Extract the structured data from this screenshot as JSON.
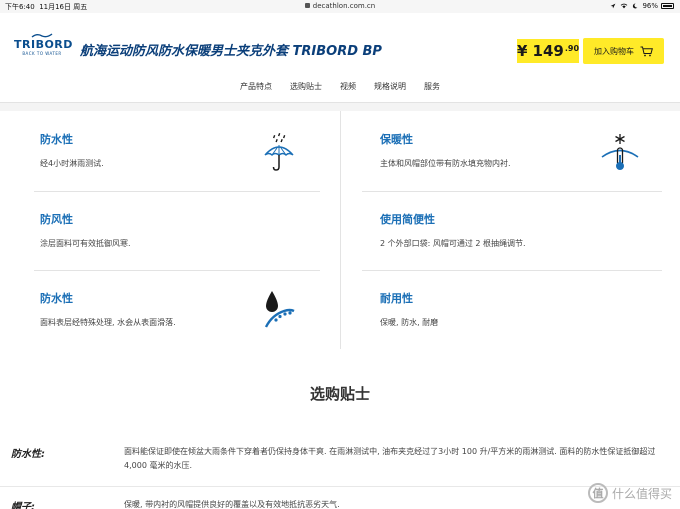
{
  "status_bar": {
    "time": "下午6:40",
    "date": "11月16日 周五",
    "url": "decathlon.com.cn",
    "battery": "96%"
  },
  "header": {
    "logo_word": "TRIBORD",
    "logo_sub": "BACK TO WATER",
    "product_title": "航海运动防风防水保暖男士夹克外套 TRIBORD BP",
    "price_symbol": "¥",
    "price_int": "149",
    "price_dec": ".90",
    "cart_label": "加入购物车"
  },
  "nav": {
    "items": [
      "产品特点",
      "选购贴士",
      "视频",
      "规格说明",
      "服务"
    ]
  },
  "features": [
    {
      "title": "防水性",
      "desc": "经4小时淋雨测试.",
      "icon": "umbrella-rain-icon"
    },
    {
      "title": "保暖性",
      "desc": "主体和风帽部位带有防水填充物内衬.",
      "icon": "thermometer-snow-icon"
    },
    {
      "title": "防风性",
      "desc": "涂层面料可有效抵御风寒.",
      "icon": ""
    },
    {
      "title": "使用简便性",
      "desc": "2 个外部口袋: 风帽可通过 2 根抽绳调节.",
      "icon": ""
    },
    {
      "title": "防水性",
      "desc": "面料表层经特殊处理, 水会从表面滑落.",
      "icon": "water-drop-icon"
    },
    {
      "title": "耐用性",
      "desc": "保暖, 防水, 耐磨",
      "icon": ""
    }
  ],
  "guide": {
    "title": "选购贴士",
    "specs": [
      {
        "label": "防水性:",
        "text": "面料能保证即使在倾盆大雨条件下穿着者仍保持身体干爽. 在雨淋测试中, 油布夹克经过了3小时 100 升/平方米的雨淋测试. 面料的防水性保证抵御超过4,000 毫米的水压."
      },
      {
        "label": "帽子:",
        "text": "保暖, 带内衬的风帽提供良好的覆盖以及有效地抵抗恶劣天气."
      }
    ]
  },
  "watermark": {
    "glyph": "值",
    "text": "什么值得买"
  },
  "colors": {
    "accent_blue": "#1b6fb6",
    "brand_navy": "#0b4e8e",
    "price_yellow": "#ffea28"
  }
}
